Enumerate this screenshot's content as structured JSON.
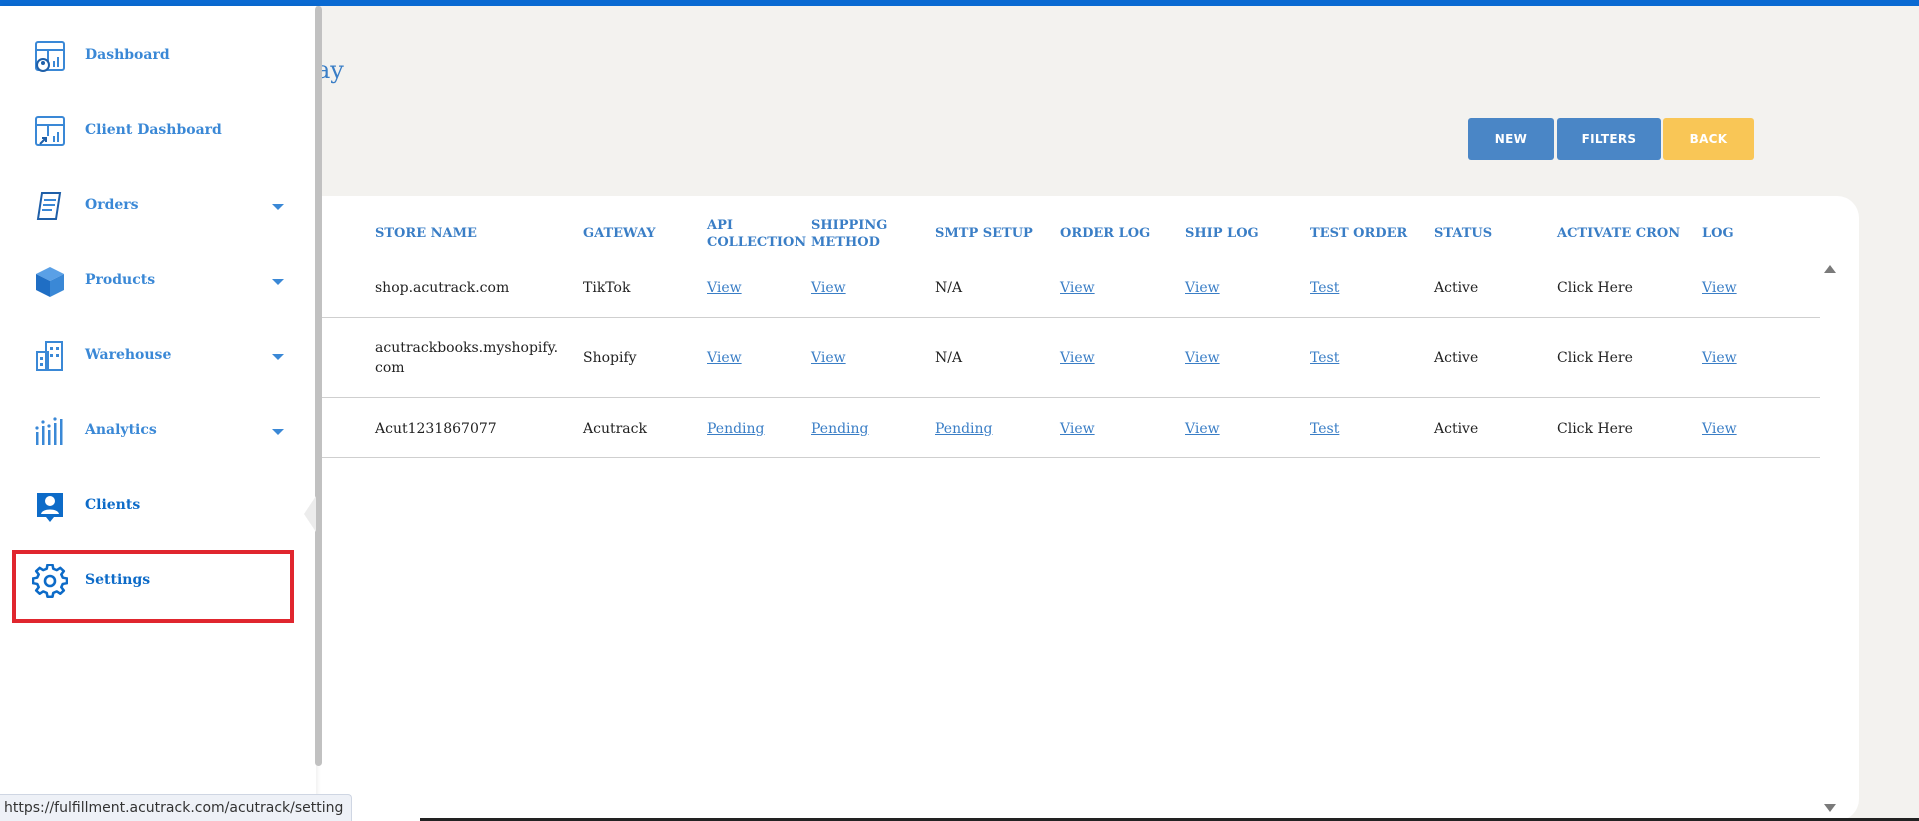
{
  "page": {
    "title_fragment": "ay"
  },
  "toolbar": {
    "new_label": "NEW",
    "filters_label": "FILTERS",
    "back_label": "BACK"
  },
  "table": {
    "headers": {
      "store_name": "STORE NAME",
      "gateway": "GATEWAY",
      "api_collection_1": "API",
      "api_collection_2": "COLLECTION",
      "shipping_method_1": "SHIPPING",
      "shipping_method_2": "METHOD",
      "smtp_setup": "SMTP SETUP",
      "order_log": "ORDER LOG",
      "ship_log": "SHIP LOG",
      "test_order": "TEST ORDER",
      "status": "STATUS",
      "activate_cron": "ACTIVATE CRON",
      "log": "LOG"
    },
    "rows": [
      {
        "store_name_1": "shop.acutrack.com",
        "store_name_2": "",
        "gateway": "TikTok",
        "api_collection": "View",
        "shipping_method": "View",
        "smtp_setup": "N/A",
        "order_log": "View",
        "ship_log": "View",
        "test_order": "Test",
        "status": "Active",
        "activate_cron": "Click Here",
        "log": "View"
      },
      {
        "store_name_1": "acutrackbooks.myshopify.",
        "store_name_2": "com",
        "gateway": "Shopify",
        "api_collection": "View",
        "shipping_method": "View",
        "smtp_setup": "N/A",
        "order_log": "View",
        "ship_log": "View",
        "test_order": "Test",
        "status": "Active",
        "activate_cron": "Click Here",
        "log": "View"
      },
      {
        "store_name_1": "Acut1231867077",
        "store_name_2": "",
        "gateway": "Acutrack",
        "api_collection": "Pending",
        "shipping_method": "Pending",
        "smtp_setup": "Pending",
        "order_log": "View",
        "ship_log": "View",
        "test_order": "Test",
        "status": "Active",
        "activate_cron": "Click Here",
        "log": "View"
      }
    ]
  },
  "sidebar": {
    "items": [
      {
        "label": "Dashboard",
        "icon": "dashboard-icon"
      },
      {
        "label": "Client Dashboard",
        "icon": "client-dashboard-icon"
      },
      {
        "label": "Orders",
        "icon": "orders-icon"
      },
      {
        "label": "Products",
        "icon": "products-icon"
      },
      {
        "label": "Warehouse",
        "icon": "warehouse-icon"
      },
      {
        "label": "Analytics",
        "icon": "analytics-icon"
      },
      {
        "label": "Clients",
        "icon": "clients-icon"
      },
      {
        "label": "Settings",
        "icon": "gear-icon"
      }
    ]
  },
  "status_bar": {
    "url": "https://fulfillment.acutrack.com/acutrack/setting"
  },
  "colors": {
    "accent": "#3a7ec6",
    "topbar": "#0a6ad2",
    "back_button": "#f9c656",
    "highlight": "#e0262e"
  }
}
